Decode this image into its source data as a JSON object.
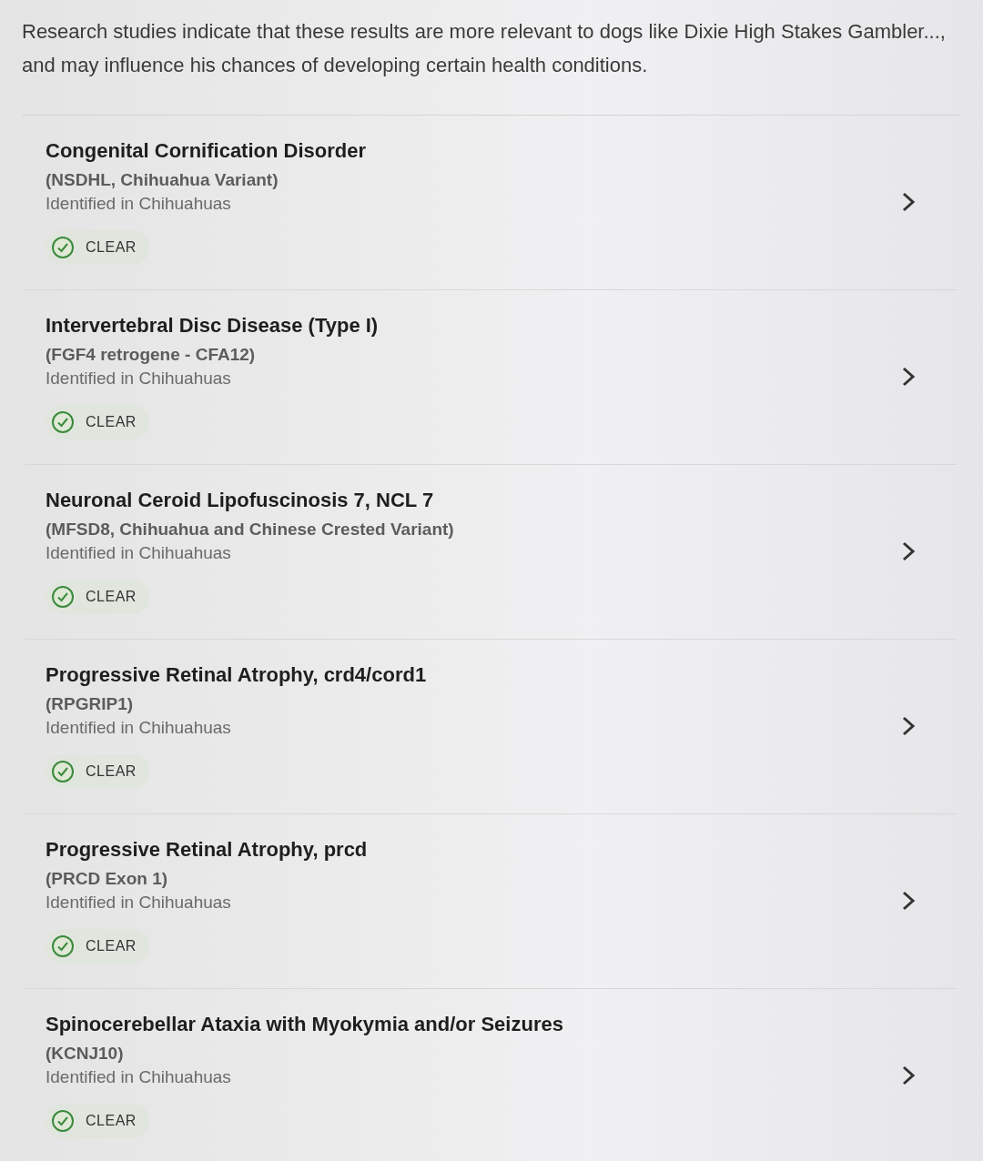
{
  "intro": "Research studies indicate that these results are more relevant to dogs like Dixie High Stakes Gambler..., and may influence his chances of developing certain health conditions.",
  "results": [
    {
      "title": "Congenital Cornification Disorder",
      "variant": "(NSDHL, Chihuahua Variant)",
      "note": "Identified in Chihuahuas",
      "status": "CLEAR"
    },
    {
      "title": "Intervertebral Disc Disease (Type I)",
      "variant": "(FGF4 retrogene - CFA12)",
      "note": "Identified in Chihuahuas",
      "status": "CLEAR"
    },
    {
      "title": "Neuronal Ceroid Lipofuscinosis 7, NCL 7",
      "variant": "(MFSD8, Chihuahua and Chinese Crested Variant)",
      "note": "Identified in Chihuahuas",
      "status": "CLEAR"
    },
    {
      "title": "Progressive Retinal Atrophy, crd4/cord1",
      "variant": "(RPGRIP1)",
      "note": "Identified in Chihuahuas",
      "status": "CLEAR"
    },
    {
      "title": "Progressive Retinal Atrophy, prcd",
      "variant": "(PRCD Exon 1)",
      "note": "Identified in Chihuahuas",
      "status": "CLEAR"
    },
    {
      "title": "Spinocerebellar Ataxia with Myokymia and/or Seizures",
      "variant": "(KCNJ10)",
      "note": "Identified in Chihuahuas",
      "status": "CLEAR"
    }
  ]
}
